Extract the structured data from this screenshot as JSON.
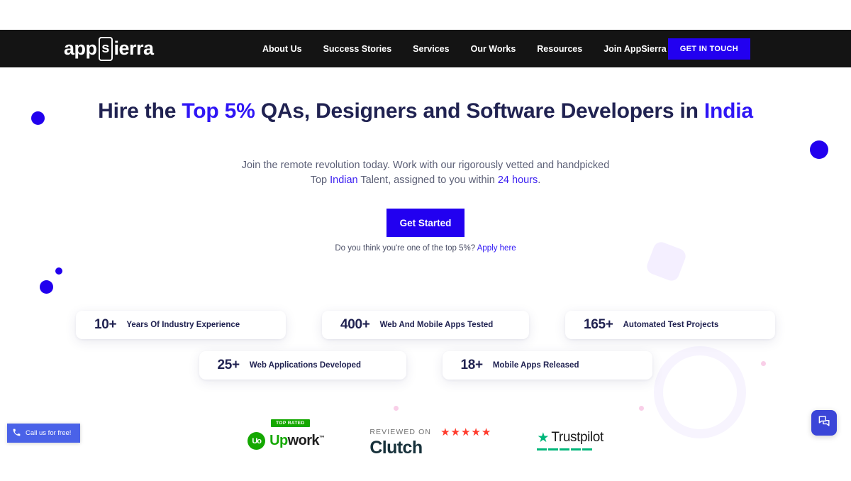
{
  "header": {
    "logo": {
      "pre": "app",
      "mark": "s",
      "post": "ierra"
    },
    "nav": [
      {
        "label": "About Us"
      },
      {
        "label": "Success Stories"
      },
      {
        "label": "Services"
      },
      {
        "label": "Our Works"
      },
      {
        "label": "Resources"
      },
      {
        "label": "Join AppSierra"
      }
    ],
    "cta_label": "GET IN TOUCH",
    "background": "#141414",
    "cta_color": "#2200f0"
  },
  "hero": {
    "headline": {
      "part1": "Hire the ",
      "highlight1": "Top 5%",
      "part2": " QAs, Designers and Software Developers in ",
      "highlight2": "India"
    },
    "subhead": {
      "line1": "Join the remote revolution today. Work with our rigorously vetted and handpicked",
      "line2_pre": "Top ",
      "line2_hl1": "Indian",
      "line2_mid": " Talent, assigned to you within ",
      "line2_hl2": "24 hours",
      "line2_end": "."
    },
    "primary_cta": "Get Started",
    "apply_text": "Do you think you're one of the top 5%? ",
    "apply_link": "Apply here",
    "accent_color": "#2200f0",
    "heading_color": "#202251"
  },
  "stats": {
    "row1": [
      {
        "number": "10+",
        "label": "Years Of Industry Experience"
      },
      {
        "number": "400+",
        "label": "Web And Mobile Apps Tested"
      },
      {
        "number": "165+",
        "label": "Automated Test Projects"
      }
    ],
    "row2": [
      {
        "number": "25+",
        "label": "Web Applications Developed"
      },
      {
        "number": "18+",
        "label": "Mobile Apps Released"
      }
    ]
  },
  "badges": {
    "upwork": {
      "top_rated": "TOP RATED",
      "logo_text": "Uo",
      "word_u": "Up",
      "word_rest": "work",
      "tm": "™"
    },
    "clutch": {
      "reviewed_on": "REVIEWED ON",
      "stars": "★★★★★",
      "name": "Clutch"
    },
    "trustpilot": {
      "star": "★",
      "name": "Trustpilot"
    }
  },
  "widgets": {
    "call": {
      "icon": "📞",
      "label": "Call us for free!",
      "color": "#4a62e8"
    },
    "chat": {
      "icon": "chat-bubbles",
      "color": "#3b46d8"
    }
  },
  "decor": {
    "blue": "#2200ee",
    "pink": "#f9cfe8",
    "lavender": "#f4efff"
  }
}
